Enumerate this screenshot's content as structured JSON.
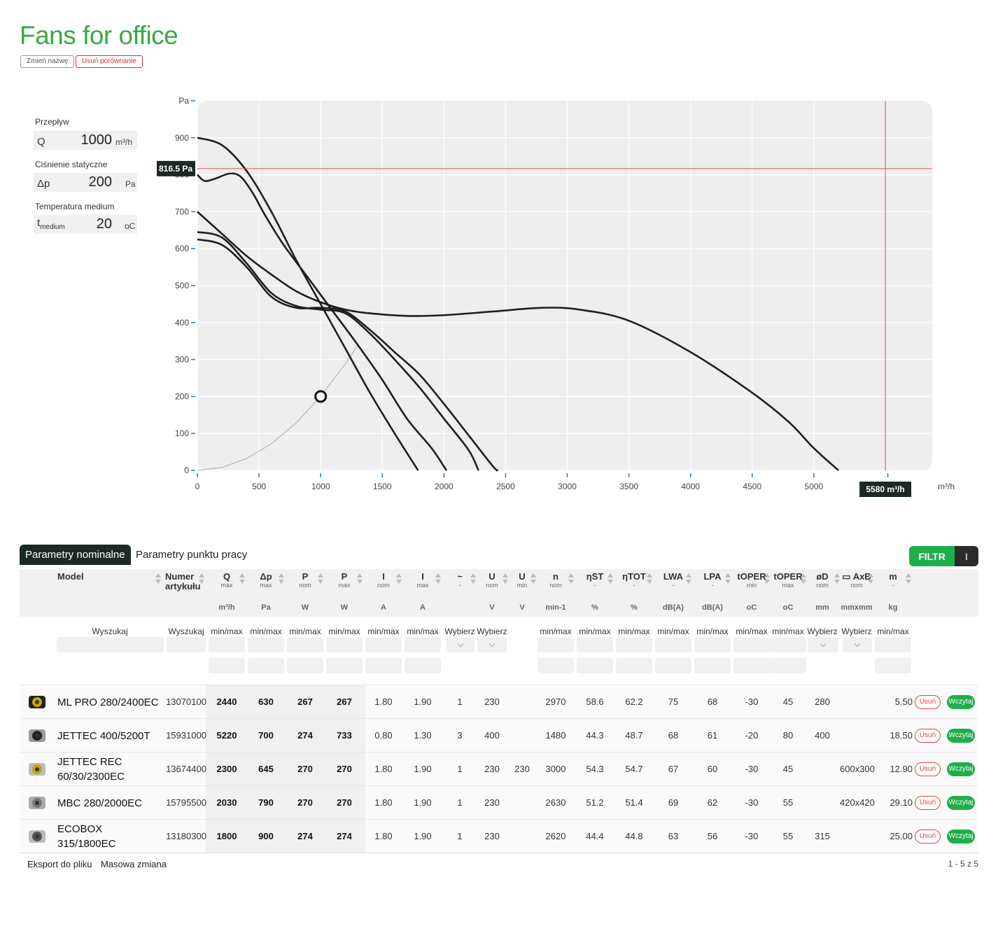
{
  "page": {
    "title": "Fans for office",
    "rename_label": "Zmień nazwę",
    "remove_label": "Usuń porównanie"
  },
  "params": [
    {
      "label": "Przepływ",
      "symbol": "Q",
      "value": "1000",
      "unit": "m³/h"
    },
    {
      "label": "Ciśnienie statyczne",
      "symbol": "Δp",
      "value": "200",
      "unit": "Pa"
    },
    {
      "label": "Temperatura medium",
      "symbol": "t",
      "symbol_sub": "medium",
      "value": "20",
      "unit": "oC"
    }
  ],
  "chart_data": {
    "type": "line",
    "xlabel": "m³/h",
    "ylabel": "Pa",
    "xlim": [
      0,
      6000
    ],
    "ylim": [
      0,
      1000
    ],
    "x_ticks": [
      0,
      500,
      1000,
      1500,
      2000,
      2500,
      3000,
      3500,
      4000,
      4500,
      5000
    ],
    "y_ticks": [
      0,
      100,
      200,
      300,
      400,
      500,
      600,
      700,
      800,
      900
    ],
    "grid": true,
    "cursor": {
      "x": 5580,
      "y": 816.5,
      "x_label": "5580 m³/h",
      "y_label": "816.5 Pa"
    },
    "work_point": {
      "x": 1000,
      "y": 200
    },
    "system_curve": [
      [
        0,
        0
      ],
      [
        200,
        8
      ],
      [
        400,
        32
      ],
      [
        600,
        72
      ],
      [
        800,
        128
      ],
      [
        1000,
        200
      ],
      [
        1200,
        288
      ],
      [
        1300,
        338
      ]
    ],
    "series": [
      {
        "values": [
          [
            0,
            900
          ],
          [
            200,
            880
          ],
          [
            400,
            810
          ],
          [
            600,
            700
          ],
          [
            800,
            570
          ],
          [
            1000,
            450
          ],
          [
            1200,
            330
          ],
          [
            1400,
            210
          ],
          [
            1600,
            100
          ],
          [
            1790,
            0
          ]
        ]
      },
      {
        "values": [
          [
            0,
            800
          ],
          [
            60,
            783
          ],
          [
            150,
            790
          ],
          [
            260,
            803
          ],
          [
            350,
            795
          ],
          [
            450,
            750
          ],
          [
            550,
            690
          ],
          [
            700,
            610
          ],
          [
            900,
            520
          ],
          [
            1100,
            430
          ],
          [
            1300,
            340
          ],
          [
            1500,
            245
          ],
          [
            1700,
            140
          ],
          [
            1900,
            60
          ],
          [
            2020,
            0
          ]
        ]
      },
      {
        "values": [
          [
            0,
            700
          ],
          [
            200,
            640
          ],
          [
            400,
            580
          ],
          [
            600,
            530
          ],
          [
            800,
            485
          ],
          [
            1000,
            455
          ],
          [
            1200,
            435
          ],
          [
            1400,
            425
          ],
          [
            1700,
            418
          ],
          [
            2000,
            420
          ],
          [
            2400,
            430
          ],
          [
            2800,
            440
          ],
          [
            3100,
            435
          ],
          [
            3500,
            405
          ],
          [
            4000,
            320
          ],
          [
            4500,
            210
          ],
          [
            4800,
            130
          ],
          [
            5000,
            60
          ],
          [
            5200,
            0
          ]
        ]
      },
      {
        "values": [
          [
            0,
            645
          ],
          [
            200,
            630
          ],
          [
            400,
            560
          ],
          [
            600,
            480
          ],
          [
            800,
            445
          ],
          [
            1000,
            435
          ],
          [
            1200,
            425
          ],
          [
            1400,
            370
          ],
          [
            1600,
            300
          ],
          [
            1800,
            225
          ],
          [
            2000,
            140
          ],
          [
            2200,
            55
          ],
          [
            2280,
            0
          ]
        ]
      },
      {
        "values": [
          [
            0,
            625
          ],
          [
            200,
            610
          ],
          [
            400,
            550
          ],
          [
            600,
            470
          ],
          [
            800,
            440
          ],
          [
            1000,
            440
          ],
          [
            1200,
            430
          ],
          [
            1400,
            380
          ],
          [
            1600,
            320
          ],
          [
            1800,
            260
          ],
          [
            2000,
            180
          ],
          [
            2200,
            95
          ],
          [
            2400,
            10
          ],
          [
            2440,
            0
          ]
        ]
      }
    ]
  },
  "tabs": {
    "nominal": "Parametry nominalne",
    "workpoint": "Parametry punktu pracy"
  },
  "filter": {
    "label": "FILTR",
    "toggle": "I"
  },
  "columns": [
    {
      "key": "model",
      "label": "Model",
      "sub": "",
      "unit": ""
    },
    {
      "key": "article",
      "label": "Numer artykułu",
      "sub": "",
      "unit": ""
    },
    {
      "key": "q",
      "label": "Q",
      "sub": "max",
      "unit": "m³/h"
    },
    {
      "key": "dp",
      "label": "Δp",
      "sub": "max",
      "unit": "Pa"
    },
    {
      "key": "pnom",
      "label": "P",
      "sub": "nom",
      "unit": "W"
    },
    {
      "key": "pmax",
      "label": "P",
      "sub": "max",
      "unit": "W"
    },
    {
      "key": "inom",
      "label": "I",
      "sub": "nom",
      "unit": "A"
    },
    {
      "key": "imax",
      "label": "I",
      "sub": "max",
      "unit": "A"
    },
    {
      "key": "phase",
      "label": "~",
      "sub": "-",
      "unit": ""
    },
    {
      "key": "unom",
      "label": "U",
      "sub": "nom",
      "unit": "V"
    },
    {
      "key": "umin",
      "label": "U",
      "sub": "min",
      "unit": "V"
    },
    {
      "key": "n",
      "label": "n",
      "sub": "nom",
      "unit": "min-1"
    },
    {
      "key": "nst",
      "label": "ηST",
      "sub": "-",
      "unit": "%"
    },
    {
      "key": "ntot",
      "label": "ηTOT",
      "sub": "-",
      "unit": "%"
    },
    {
      "key": "lwa",
      "label": "LWA",
      "sub": "-",
      "unit": "dB(A)"
    },
    {
      "key": "lpa",
      "label": "LPA",
      "sub": "-",
      "unit": "dB(A)"
    },
    {
      "key": "tmin",
      "label": "tOPER",
      "sub": "min",
      "unit": "oC"
    },
    {
      "key": "tmax",
      "label": "tOPER",
      "sub": "max",
      "unit": "oC"
    },
    {
      "key": "d",
      "label": "øD",
      "sub": "nom",
      "unit": "mm"
    },
    {
      "key": "axb",
      "label": "▭ AxB",
      "sub": "nom",
      "unit": "mmxmm"
    },
    {
      "key": "m",
      "label": "m",
      "sub": "-",
      "unit": "kg"
    }
  ],
  "filter_labels": {
    "search": "Wyszukaj",
    "minmax": "min/max",
    "select": "Wybierz"
  },
  "rows": [
    {
      "model": "ML PRO 280/2400EC",
      "article": "13070100",
      "q": "2440",
      "dp": "630",
      "pnom": "267",
      "pmax": "267",
      "inom": "1.80",
      "imax": "1.90",
      "phase": "1",
      "unom": "230",
      "umin": "",
      "n": "2970",
      "nst": "58.6",
      "ntot": "62.2",
      "lwa": "75",
      "lpa": "68",
      "tmin": "-30",
      "tmax": "45",
      "d": "280",
      "axb": "",
      "m": "5.50"
    },
    {
      "model": "JETTEC 400/5200T",
      "article": "15931000",
      "q": "5220",
      "dp": "700",
      "pnom": "274",
      "pmax": "733",
      "inom": "0.80",
      "imax": "1.30",
      "phase": "3",
      "unom": "400",
      "umin": "",
      "n": "1480",
      "nst": "44.3",
      "ntot": "48.7",
      "lwa": "68",
      "lpa": "61",
      "tmin": "-20",
      "tmax": "80",
      "d": "400",
      "axb": "",
      "m": "18.50"
    },
    {
      "model": "JETTEC REC 60/30/2300EC",
      "article": "13674400",
      "q": "2300",
      "dp": "645",
      "pnom": "270",
      "pmax": "270",
      "inom": "1.80",
      "imax": "1.90",
      "phase": "1",
      "unom": "230",
      "umin": "230",
      "n": "3000",
      "nst": "54.3",
      "ntot": "54.7",
      "lwa": "67",
      "lpa": "60",
      "tmin": "-30",
      "tmax": "45",
      "d": "",
      "axb": "600x300",
      "m": "12.90"
    },
    {
      "model": "MBC 280/2000EC",
      "article": "15795500",
      "q": "2030",
      "dp": "790",
      "pnom": "270",
      "pmax": "270",
      "inom": "1.80",
      "imax": "1.90",
      "phase": "1",
      "unom": "230",
      "umin": "",
      "n": "2630",
      "nst": "51.2",
      "ntot": "51.4",
      "lwa": "69",
      "lpa": "62",
      "tmin": "-30",
      "tmax": "55",
      "d": "",
      "axb": "420x420",
      "m": "29.10"
    },
    {
      "model": "ECOBOX 315/1800EC",
      "article": "13180300",
      "q": "1800",
      "dp": "900",
      "pnom": "274",
      "pmax": "274",
      "inom": "1.80",
      "imax": "1.90",
      "phase": "1",
      "unom": "230",
      "umin": "",
      "n": "2620",
      "nst": "44.4",
      "ntot": "44.8",
      "lwa": "63",
      "lpa": "56",
      "tmin": "-30",
      "tmax": "55",
      "d": "315",
      "axb": "",
      "m": "25.00"
    }
  ],
  "row_actions": {
    "remove": "Usuń",
    "load": "Wczytaj"
  },
  "footer": {
    "export": "Eksport do pliku",
    "bulk": "Masowa zmiana",
    "pager": "1 - 5 z 5"
  },
  "colors": {
    "brand_green": "#3aa845",
    "button_green": "#1fae4b",
    "dark": "#1c2a26",
    "cursor_red": "#e05050"
  }
}
